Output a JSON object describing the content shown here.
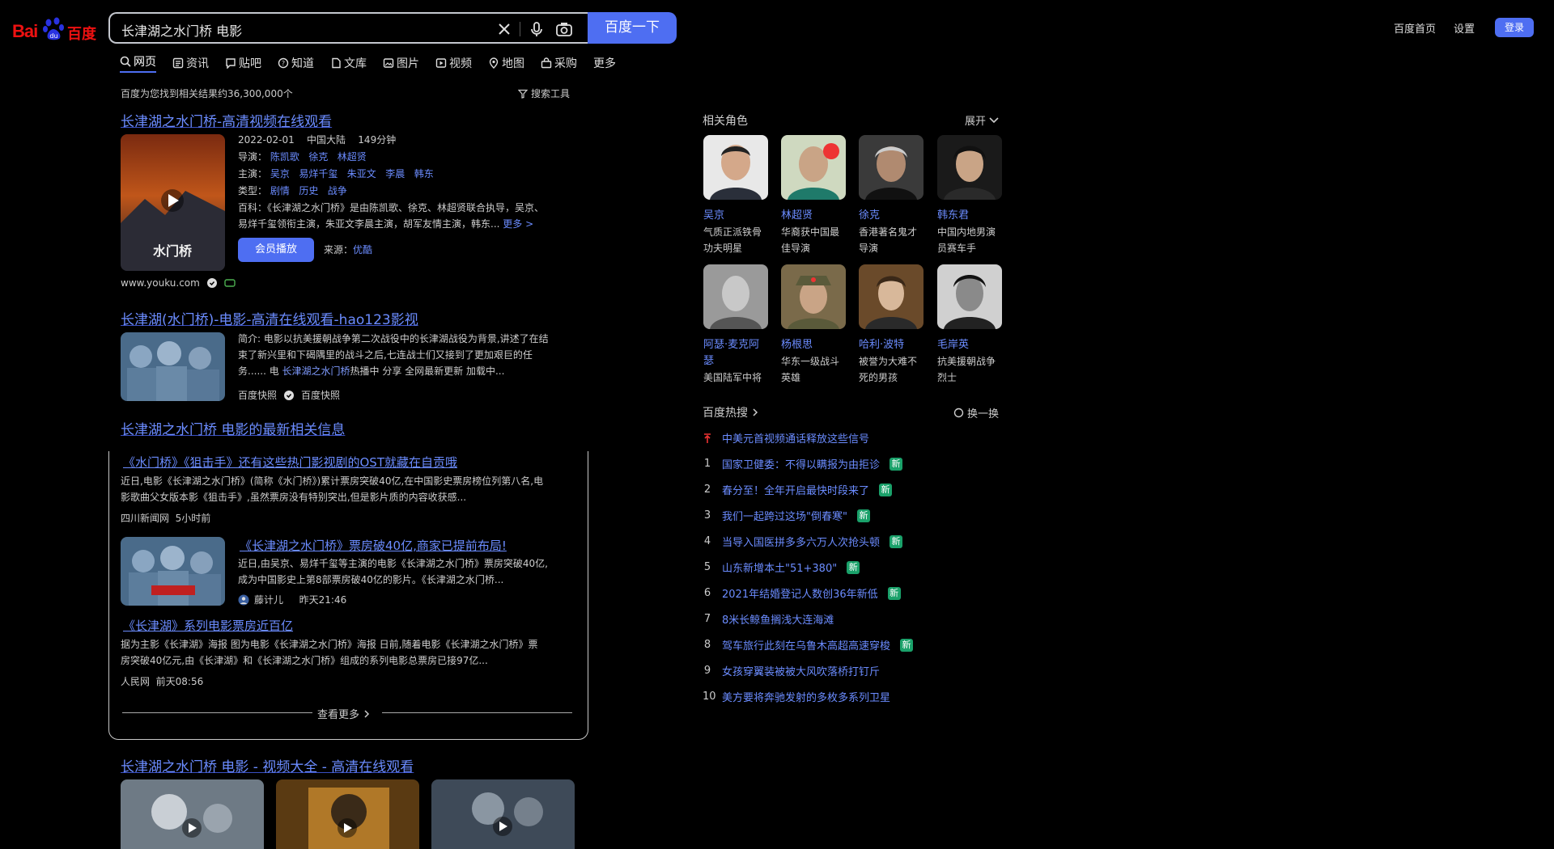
{
  "header": {
    "logo_bai": "Bai",
    "logo_du": "百度",
    "query": "长津湖之水门桥 电影",
    "search_button": "百度一下",
    "links": [
      "百度首页",
      "设置"
    ],
    "login": "登录"
  },
  "tabs": [
    {
      "label": "网页",
      "icon": "search-icon"
    },
    {
      "label": "资讯",
      "icon": "news-icon"
    },
    {
      "label": "贴吧",
      "icon": "tieba-icon"
    },
    {
      "label": "知道",
      "icon": "question-icon"
    },
    {
      "label": "文库",
      "icon": "doc-icon"
    },
    {
      "label": "图片",
      "icon": "image-icon"
    },
    {
      "label": "视频",
      "icon": "video-icon"
    },
    {
      "label": "地图",
      "icon": "map-icon"
    },
    {
      "label": "采购",
      "icon": "shop-icon"
    },
    {
      "label": "更多",
      "icon": ""
    }
  ],
  "result_count": "百度为您找到相关结果约36,300,000个",
  "search_tools": "搜索工具",
  "r1": {
    "title": "长津湖之水门桥-高清视频在线观看",
    "meta": [
      "2022-02-01",
      "中国大陆",
      "149分钟"
    ],
    "director_label": "导演：",
    "directors": [
      "陈凯歌",
      "徐克",
      "林超贤"
    ],
    "cast_label": "主演：",
    "cast": [
      "吴京",
      "易烊千玺",
      "朱亚文",
      "李晨",
      "韩东"
    ],
    "genre_label": "类型：",
    "genres": [
      "剧情",
      "历史",
      "战争"
    ],
    "summary_line1": "百科：《长津湖之水门桥》是由陈凯歌、徐克、林超贤联合执导，吴京、",
    "summary_line2": "易烊千玺领衔主演，朱亚文李晨主演，胡军友情主演，韩东...",
    "more": "更多 >",
    "play": "会员播放",
    "source_label": "来源：",
    "source": "优酷",
    "url": "www.youku.com"
  },
  "r2": {
    "title": "长津湖(水门桥)-电影-高清在线观看-hao123影视",
    "line1": "简介: 电影以抗美援朝战争第二次战役中的长津湖战役为背景,讲述了在结",
    "line2": "束了新兴里和下碣隅里的战斗之后,七连战士们又接到了更加艰巨的任",
    "line3a": "务...... 电",
    "line3b": "长津湖之水门桥",
    "line3c": "热播中 分享 全网最新更新 加载中...",
    "src1": "百度快照",
    "src2": "百度快照"
  },
  "news": {
    "header": "长津湖之水门桥 电影的最新相关信息",
    "item1_title": "《水门桥》《狙击手》还有这些热门影视剧的OST就藏在自贡哦",
    "item1_line1": "近日,电影《长津湖之水门桥》(简称《水门桥》)累计票房突破40亿,在中国影史票房榜位列第八名,电",
    "item1_line2": "影歌曲父女版本影《狙击手》,虽然票房没有特别突出,但是影片质的内容收获感...",
    "item1_src": "四川新闻网",
    "item1_time": "5小时前",
    "item2_title": "《长津湖之水门桥》票房破40亿,商家已提前布局!",
    "item2_line1": "近日,由吴京、易烊千玺等主演的电影《长津湖之水门桥》票房突破40亿,",
    "item2_line2": "成为中国影史上第8部票房破40亿的影片。《长津湖之水门桥...",
    "item2_src": "藤计儿",
    "item2_time": "昨天21:46",
    "item3_title": "《长津湖》系列电影票房近百亿",
    "item3_line1": "据为主影《长津湖》海报 图为电影《长津湖之水门桥》海报 日前,随着电影《长津湖之水门桥》票",
    "item3_line2": "房突破40亿元,由《长津湖》和《长津湖之水门桥》组成的系列电影总票房已接97亿...",
    "item3_src": "人民网",
    "item3_time": "前天08:56",
    "more": "查看更多"
  },
  "r4": {
    "title": "长津湖之水门桥 电影 - 视频大全 - 高清在线观看"
  },
  "related": {
    "title": "相关角色",
    "expand": "展开",
    "people": [
      {
        "name": "吴京",
        "desc": [
          "气质正派铁骨",
          "功夫明星"
        ]
      },
      {
        "name": "林超贤",
        "desc": [
          "华裔获中国最",
          "佳导演"
        ]
      },
      {
        "name": "徐克",
        "desc": [
          "香港著名鬼才",
          "导演"
        ]
      },
      {
        "name": "韩东君",
        "desc": [
          "中国内地男演",
          "员赛车手"
        ]
      },
      {
        "name": "阿瑟·麦克阿",
        "name2": "瑟",
        "desc": [
          "美国陆军中将"
        ]
      },
      {
        "name": "杨根思",
        "desc": [
          "华东一级战斗",
          "英雄"
        ]
      },
      {
        "name": "哈利·波特",
        "desc": [
          "被誉为大难不",
          "死的男孩"
        ]
      },
      {
        "name": "毛岸英",
        "desc": [
          "抗美援朝战争",
          "烈士"
        ]
      }
    ]
  },
  "hotlist": {
    "title": "百度热搜",
    "refresh": "换一换",
    "items": [
      {
        "n": "置顶",
        "text": "中美元首视频通话释放这些信号",
        "badge": ""
      },
      {
        "n": "1",
        "text": "国家卫健委：不得以瞒报为由拒诊",
        "badge": "新"
      },
      {
        "n": "2",
        "text": "春分至！全年开启最快时段来了",
        "badge": "新"
      },
      {
        "n": "3",
        "text": "我们一起跨过这场\"倒春寒\"",
        "badge": "新"
      },
      {
        "n": "4",
        "text": "当导入国医拼多多六万人次抢头顿",
        "badge": "新"
      },
      {
        "n": "5",
        "text": "山东新增本土\"51+380\"",
        "badge": "新"
      },
      {
        "n": "6",
        "text": "2021年结婚登记人数创36年新低",
        "badge": "新"
      },
      {
        "n": "7",
        "text": "8米长鲸鱼搁浅大连海滩",
        "badge": ""
      },
      {
        "n": "8",
        "text": "驾车旅行此刻在乌鲁木高超高速穿梭",
        "badge": "新"
      },
      {
        "n": "9",
        "text": "女孩穿翼装被被大风吹落桥打钉斤",
        "badge": ""
      },
      {
        "n": "10",
        "text": "美方要将奔驰发射的多枚多系列卫星",
        "badge": ""
      }
    ]
  }
}
